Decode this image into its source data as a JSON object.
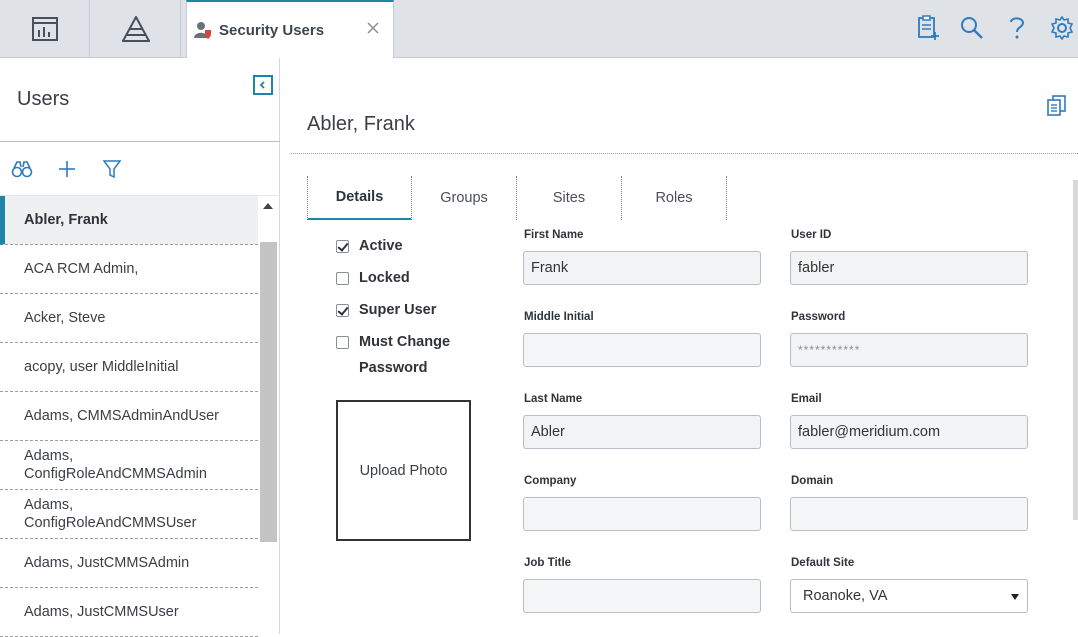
{
  "topbar": {
    "tab_title": "Security Users",
    "icons": [
      "dashboard-icon",
      "hierarchy-icon",
      "add-report-icon",
      "search-icon",
      "help-icon",
      "settings-icon"
    ]
  },
  "left_panel": {
    "title": "Users",
    "toolbar": [
      "binoculars-icon",
      "plus-icon",
      "filter-icon"
    ],
    "users": [
      "Abler, Frank",
      "ACA RCM Admin,",
      "Acker, Steve",
      "acopy, user MiddleInitial",
      "Adams, CMMSAdminAndUser",
      "Adams, ConfigRoleAndCMMSAdmin",
      "Adams, ConfigRoleAndCMMSUser",
      "Adams, JustCMMSAdmin",
      "Adams, JustCMMSUser"
    ],
    "selected_index": 0
  },
  "main": {
    "title": "Abler, Frank",
    "tabs": [
      "Details",
      "Groups",
      "Sites",
      "Roles"
    ],
    "active_tab": "Details",
    "checkboxes": [
      {
        "label": "Active",
        "checked": true
      },
      {
        "label": "Locked",
        "checked": false
      },
      {
        "label": "Super User",
        "checked": true
      },
      {
        "label": "Must Change Password",
        "checked": false
      }
    ],
    "upload_photo_label": "Upload Photo",
    "fields": {
      "first_name": {
        "label": "First Name",
        "value": "Frank"
      },
      "user_id": {
        "label": "User ID",
        "value": "fabler"
      },
      "middle_initial": {
        "label": "Middle Initial",
        "value": ""
      },
      "password": {
        "label": "Password",
        "value": "***********"
      },
      "last_name": {
        "label": "Last Name",
        "value": "Abler"
      },
      "email": {
        "label": "Email",
        "value": "fabler@meridium.com"
      },
      "company": {
        "label": "Company",
        "value": ""
      },
      "domain": {
        "label": "Domain",
        "value": ""
      },
      "job_title": {
        "label": "Job Title",
        "value": ""
      },
      "default_site": {
        "label": "Default Site",
        "value": "Roanoke, VA"
      }
    }
  },
  "colors": {
    "accent": "#1f85a6",
    "topbar_bg": "#dfe3e8",
    "icon_blue": "#2e7bbf"
  }
}
